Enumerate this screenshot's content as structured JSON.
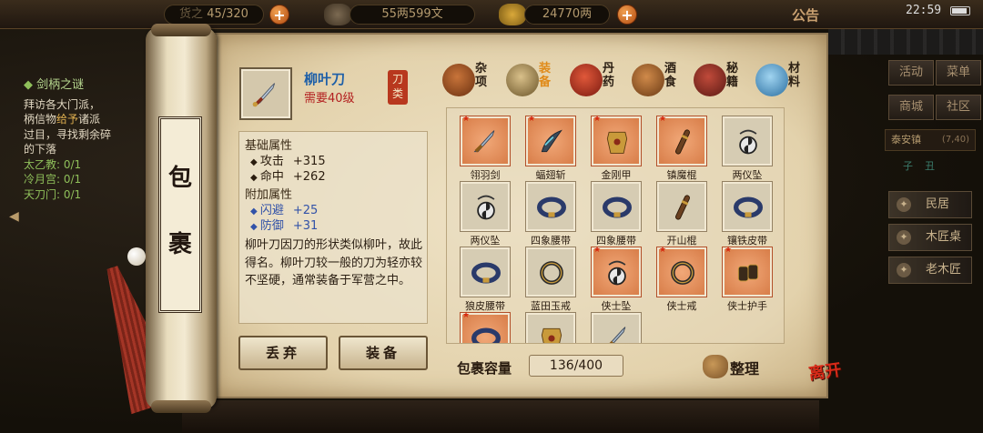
{
  "top_bar": {
    "backpack_label": "货之",
    "backpack_value": "45/320",
    "money_copper": "55两599文",
    "money_silver": "24770两",
    "notice": "公告",
    "time": "22:59"
  },
  "quest": {
    "title": "剑柄之谜",
    "desc_1": "拜访各大门派，",
    "desc_2a": "柄信物",
    "desc_2b": "给予",
    "desc_2c": "诸派",
    "desc_3": "过目，寻找剩余碎",
    "desc_4": "的下落",
    "factions": [
      {
        "name": "太乙教",
        "progress": "0/1"
      },
      {
        "name": "冷月宫",
        "progress": "0/1"
      },
      {
        "name": "天刀门",
        "progress": "0/1"
      }
    ]
  },
  "right_menu": {
    "buttons": [
      "活动",
      "菜单",
      "商城",
      "社区"
    ],
    "location": "泰安镇",
    "coords": "(7,40)",
    "time_marks": [
      "子",
      "丑"
    ],
    "npcs": [
      "民居",
      "木匠桌",
      "老木匠"
    ]
  },
  "scroll": {
    "label_top": "包",
    "label_bottom": "裹"
  },
  "selected_item": {
    "name": "柳叶刀",
    "requirement": "需要40级",
    "category_stamp": "刀类",
    "base_title": "基础属性",
    "base_stats": [
      {
        "name": "攻击",
        "value": "+315"
      },
      {
        "name": "命中",
        "value": "+262"
      }
    ],
    "extra_title": "附加属性",
    "extra_stats": [
      {
        "name": "闪避",
        "value": "+25"
      },
      {
        "name": "防御",
        "value": "+31"
      }
    ],
    "description": "柳叶刀因刀的形状类似柳叶，故此得名。柳叶刀较一般的刀为轻亦较不坚硬，通常装备于军营之中。"
  },
  "tabs": [
    {
      "label": "杂项",
      "icon": "jar-icon",
      "active": false
    },
    {
      "label": "装备",
      "icon": "equipment-icon",
      "active": true
    },
    {
      "label": "丹药",
      "icon": "pill-icon",
      "active": false
    },
    {
      "label": "酒食",
      "icon": "wine-food-icon",
      "active": false
    },
    {
      "label": "秘籍",
      "icon": "book-icon",
      "active": false
    },
    {
      "label": "材料",
      "icon": "crystal-icon",
      "active": false
    }
  ],
  "inventory": [
    {
      "name": "翎羽剑",
      "rare": true,
      "icon": "sword-icon"
    },
    {
      "name": "蝠翅斩",
      "rare": true,
      "icon": "blade-icon"
    },
    {
      "name": "金刚甲",
      "rare": true,
      "icon": "armor-icon"
    },
    {
      "name": "镇魔棍",
      "rare": true,
      "icon": "staff-icon"
    },
    {
      "name": "两仪坠",
      "rare": false,
      "icon": "pendant-icon"
    },
    {
      "name": "两仪坠",
      "rare": false,
      "icon": "pendant-icon"
    },
    {
      "name": "四象腰带",
      "rare": false,
      "icon": "belt-icon"
    },
    {
      "name": "四象腰带",
      "rare": false,
      "icon": "belt-icon"
    },
    {
      "name": "开山棍",
      "rare": false,
      "icon": "staff-icon"
    },
    {
      "name": "镶铁皮带",
      "rare": false,
      "icon": "belt-icon"
    },
    {
      "name": "狼皮腰带",
      "rare": false,
      "icon": "belt-icon"
    },
    {
      "name": "蓝田玉戒",
      "rare": false,
      "icon": "ring-icon"
    },
    {
      "name": "侠士坠",
      "rare": true,
      "icon": "pendant-icon"
    },
    {
      "name": "侠士戒",
      "rare": true,
      "icon": "ring-icon"
    },
    {
      "name": "侠士护手",
      "rare": true,
      "icon": "gauntlet-icon"
    },
    {
      "name": "",
      "rare": true,
      "icon": "belt-icon"
    },
    {
      "name": "",
      "rare": false,
      "icon": "armor-icon"
    },
    {
      "name": "",
      "rare": false,
      "icon": "sword-icon"
    }
  ],
  "capacity": {
    "label": "包裹容量",
    "value": "136/400"
  },
  "actions": {
    "discard": "丢弃",
    "equip": "装备",
    "sort": "整理",
    "leave": "离开"
  },
  "colors": {
    "item_name": "#1d5fa8",
    "requirement": "#b32020",
    "extra_stat": "#3252a8",
    "rare_bg": "#d67a45",
    "active_tab": "#e08a18"
  }
}
